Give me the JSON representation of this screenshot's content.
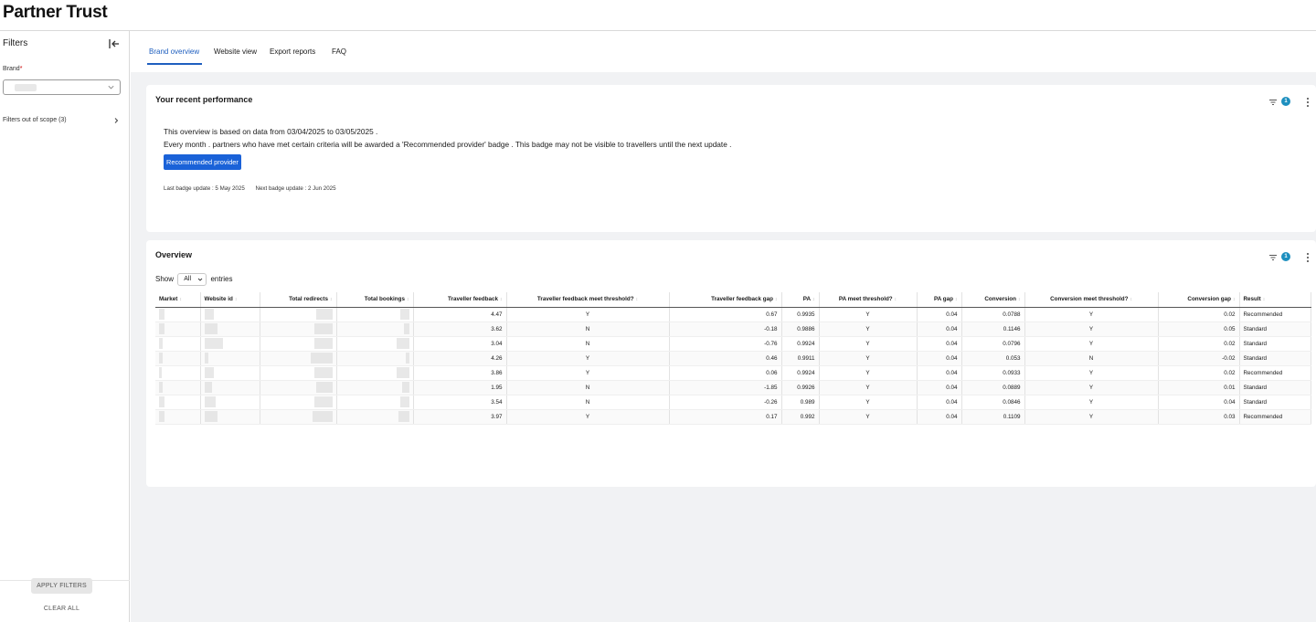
{
  "app": {
    "title": "Partner Trust"
  },
  "sidebar": {
    "title": "Filters",
    "brand_label": "Brand",
    "brand_required_mark": "*",
    "scope_label": "Filters out of scope (3)",
    "apply_label": "APPLY FILTERS",
    "clear_label": "CLEAR ALL"
  },
  "tabs": [
    {
      "label": "Brand overview",
      "active": true
    },
    {
      "label": "Website view",
      "active": false
    },
    {
      "label": "Export reports",
      "active": false
    },
    {
      "label": "FAQ",
      "active": false
    }
  ],
  "performance": {
    "title": "Your recent performance",
    "filter_count": "1",
    "line1": "This overview is based on data from 03/04/2025 to 03/05/2025 .",
    "line2": "Every month .  partners who have met certain criteria will be awarded a 'Recommended provider' badge .  This badge may not be visible to travellers until the next update .",
    "badge_label": "Recommended provider",
    "last_update": "Last badge update :  5 May 2025",
    "next_update": "Next badge update :  2 Jun 2025"
  },
  "overview": {
    "title": "Overview",
    "filter_count": "1",
    "show_label": "Show",
    "entries_value": "All",
    "entries_label": "entries",
    "columns": [
      "Market",
      "Website id",
      "Total redirects",
      "Total bookings",
      "Traveller feedback",
      "Traveller feedback meet threshold?",
      "Traveller feedback gap",
      "PA",
      "PA meet threshold?",
      "PA gap",
      "Conversion",
      "Conversion meet threshold?",
      "Conversion gap",
      "Result"
    ],
    "rows": [
      [
        "4.47",
        "Y",
        "0.67",
        "0.9935",
        "Y",
        "0.04",
        "0.0788",
        "Y",
        "0.02",
        "Recommended"
      ],
      [
        "3.62",
        "N",
        "-0.18",
        "0.9886",
        "Y",
        "0.04",
        "0.1146",
        "Y",
        "0.05",
        "Standard"
      ],
      [
        "3.04",
        "N",
        "-0.76",
        "0.9924",
        "Y",
        "0.04",
        "0.0796",
        "Y",
        "0.02",
        "Standard"
      ],
      [
        "4.26",
        "Y",
        "0.46",
        "0.9911",
        "Y",
        "0.04",
        "0.053",
        "N",
        "-0.02",
        "Standard"
      ],
      [
        "3.86",
        "Y",
        "0.06",
        "0.9924",
        "Y",
        "0.04",
        "0.0933",
        "Y",
        "0.02",
        "Recommended"
      ],
      [
        "1.95",
        "N",
        "-1.85",
        "0.9926",
        "Y",
        "0.04",
        "0.0889",
        "Y",
        "0.01",
        "Standard"
      ],
      [
        "3.54",
        "N",
        "-0.26",
        "0.989",
        "Y",
        "0.04",
        "0.0846",
        "Y",
        "0.04",
        "Standard"
      ],
      [
        "3.97",
        "Y",
        "0.17",
        "0.992",
        "Y",
        "0.04",
        "0.1109",
        "Y",
        "0.03",
        "Recommended"
      ]
    ]
  },
  "colors": {
    "accent": "#1f5fbf",
    "badge": "#1a62d8",
    "count_badge": "#1d8fbf"
  },
  "icons": [
    "collapse-panel-icon",
    "chevron-down-icon",
    "chevron-right-icon",
    "filter-icon",
    "kebab-menu-icon"
  ]
}
